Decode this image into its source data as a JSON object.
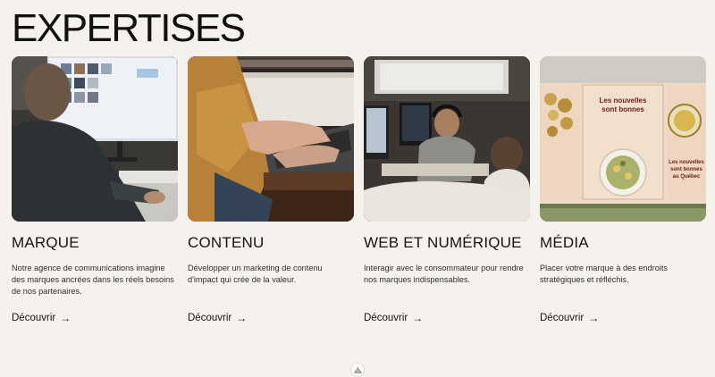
{
  "page": {
    "title": "EXPERTISES"
  },
  "cards": [
    {
      "title": "MARQUE",
      "description": "Notre agence de communications imagine des marques ancrées dans les réels besoins de nos partenaires.",
      "link_label": "Découvrir",
      "link_icon": "→",
      "image_alt": "Personne travaillant devant un écran affichant des photos"
    },
    {
      "title": "CONTENU",
      "description": "Développer un marketing de contenu d'impact qui crée de la valeur.",
      "link_label": "Découvrir",
      "link_icon": "→",
      "image_alt": "Mains tapant sur un clavier d'ordinateur portable"
    },
    {
      "title": "WEB ET NUMÉRIQUE",
      "description": "Interagir avec le consommateur pour rendre nos marques indispensables.",
      "link_label": "Découvrir",
      "link_icon": "→",
      "image_alt": "Bureau avec personnes travaillant sur des ordinateurs"
    },
    {
      "title": "MÉDIA",
      "description": "Placer votre marque à des endroits stratégiques et réfléchis.",
      "link_label": "Découvrir",
      "link_icon": "→",
      "image_alt": "Affiches publicitaires extérieures",
      "poster_text": [
        "Les nouvelles",
        "sont bonnes",
        "au Québec"
      ]
    }
  ],
  "colors": {
    "background": "#f5f2ee",
    "text": "#141414",
    "poster": "#f0d9c6"
  }
}
